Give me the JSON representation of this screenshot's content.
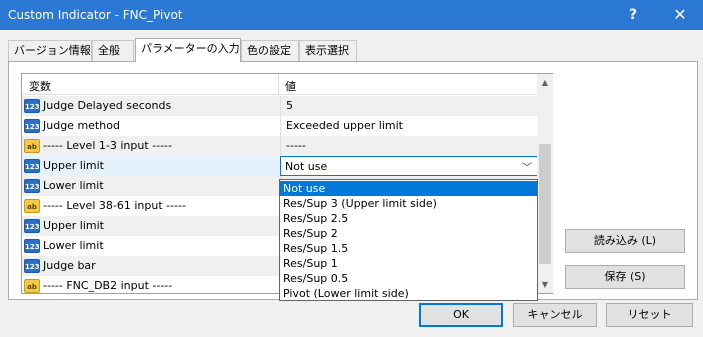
{
  "window": {
    "title": "Custom Indicator - FNC_Pivot",
    "help_label": "?",
    "close_label": "✕"
  },
  "tabs": [
    {
      "label": "バージョン情報"
    },
    {
      "label": "全般"
    },
    {
      "label": "パラメーターの入力"
    },
    {
      "label": "色の設定"
    },
    {
      "label": "表示選択"
    }
  ],
  "grid": {
    "col_variable": "変数",
    "col_value": "値",
    "rows": [
      {
        "icon": "123",
        "name": "Judge Delayed seconds",
        "value": "5"
      },
      {
        "icon": "123",
        "name": "Judge method",
        "value": "Exceeded upper limit"
      },
      {
        "icon": "ab",
        "name": "----- Level 1-3 input -----",
        "value": "-----"
      },
      {
        "icon": "123",
        "name": "Upper limit",
        "value": "Not use"
      },
      {
        "icon": "123",
        "name": "Lower limit",
        "value": ""
      },
      {
        "icon": "ab",
        "name": "----- Level 38-61 input -----",
        "value": ""
      },
      {
        "icon": "123",
        "name": "Upper limit",
        "value": ""
      },
      {
        "icon": "123",
        "name": "Lower limit",
        "value": ""
      },
      {
        "icon": "123",
        "name": "Judge bar",
        "value": ""
      },
      {
        "icon": "ab",
        "name": "----- FNC_DB2 input -----",
        "value": ""
      }
    ]
  },
  "dropdown": {
    "options": [
      "Not use",
      "Res/Sup 3 (Upper limit side)",
      "Res/Sup 2.5",
      "Res/Sup 2",
      "Res/Sup 1.5",
      "Res/Sup 1",
      "Res/Sup 0.5",
      "Pivot (Lower limit side)"
    ],
    "selected": "Not use"
  },
  "buttons": {
    "load": "読み込み (L)",
    "save": "保存 (S)",
    "ok": "OK",
    "cancel": "キャンセル",
    "reset": "リセット"
  },
  "icons": {
    "scroll_up": "▲",
    "scroll_down": "▼",
    "combo_arrow": "﹀"
  }
}
